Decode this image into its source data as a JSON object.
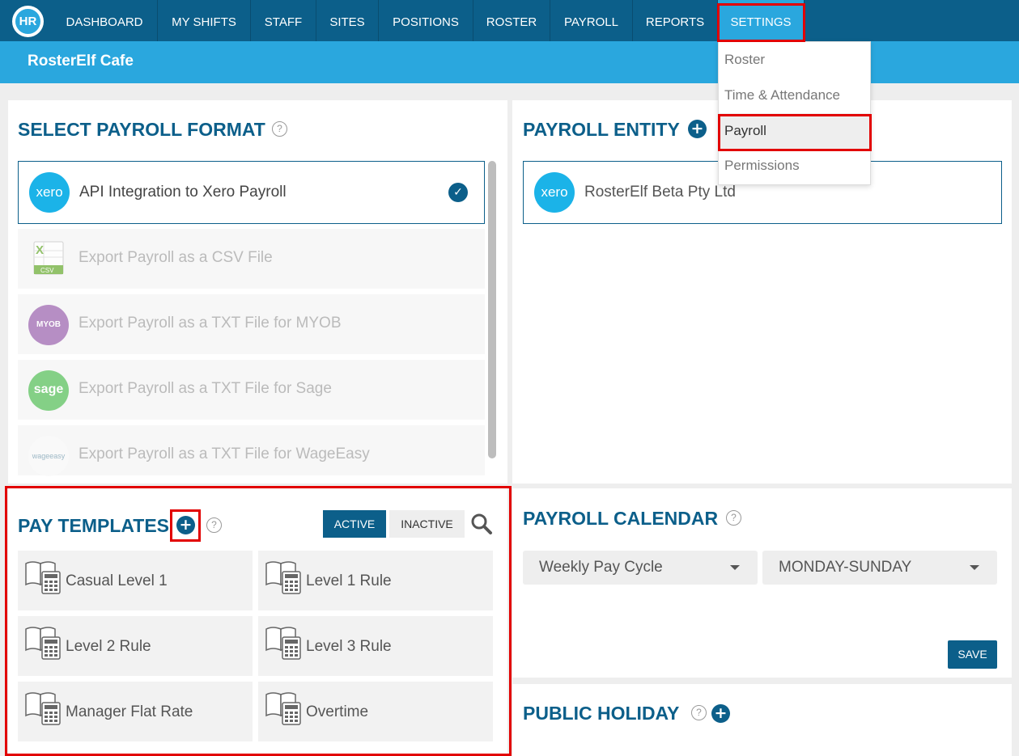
{
  "nav": {
    "logo_text": "HR",
    "items": [
      "DASHBOARD",
      "MY SHIFTS",
      "STAFF",
      "SITES",
      "POSITIONS",
      "ROSTER",
      "PAYROLL",
      "REPORTS",
      "SETTINGS"
    ]
  },
  "settings_menu": {
    "items": [
      "Roster",
      "Time & Attendance",
      "Payroll",
      "Permissions"
    ],
    "current": "Payroll"
  },
  "subbar": {
    "business_name": "RosterElf Cafe"
  },
  "payroll_format": {
    "title": "SELECT PAYROLL FORMAT",
    "help": "?",
    "options": [
      {
        "label": "API Integration to Xero Payroll",
        "icon": "xero-logo",
        "icon_text": "xero",
        "selected": true
      },
      {
        "label": "Export Payroll as a CSV File",
        "icon": "csv-file-icon",
        "icon_text": "CSV",
        "selected": false
      },
      {
        "label": "Export Payroll as a TXT File for MYOB",
        "icon": "myob-logo",
        "icon_text": "MYOB",
        "selected": false
      },
      {
        "label": "Export Payroll as a TXT File for Sage",
        "icon": "sage-logo",
        "icon_text": "sage",
        "selected": false
      },
      {
        "label": "Export Payroll as a TXT File for WageEasy",
        "icon": "wageeasy-logo",
        "icon_text": "wageeasy",
        "selected": false
      }
    ],
    "check_glyph": "✓"
  },
  "payroll_entity": {
    "title": "PAYROLL ENTITY",
    "add_glyph": "+",
    "entity": {
      "name": "RosterElf Beta Pty Ltd",
      "icon_text": "xero"
    }
  },
  "pay_templates": {
    "title": "PAY TEMPLATES",
    "add_glyph": "+",
    "help": "?",
    "filter_active": "ACTIVE",
    "filter_inactive": "INACTIVE",
    "selected_filter": "ACTIVE",
    "templates": [
      "Casual Level 1",
      "Level 1 Rule",
      "Level 2 Rule",
      "Level 3 Rule",
      "Manager Flat Rate",
      "Overtime"
    ]
  },
  "payroll_calendar": {
    "title": "PAYROLL CALENDAR",
    "help": "?",
    "pay_cycle": "Weekly Pay Cycle",
    "week_range": "MONDAY-SUNDAY",
    "save_label": "SAVE"
  },
  "public_holiday": {
    "title": "PUBLIC HOLIDAY",
    "help": "?",
    "add_glyph": "+"
  },
  "colors": {
    "nav_bg": "#0c5f8a",
    "accent": "#2aa7de",
    "highlight": "#e20000"
  }
}
